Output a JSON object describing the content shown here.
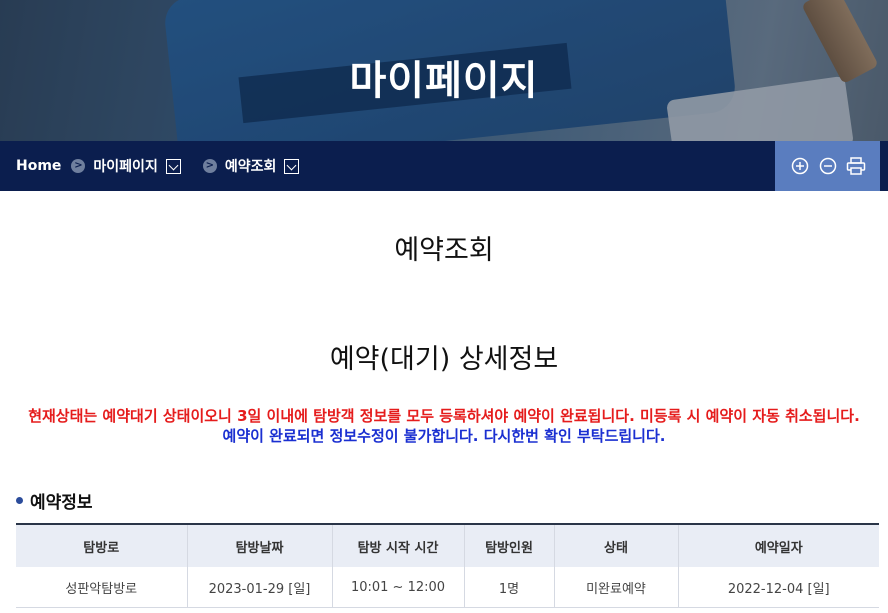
{
  "hero": {
    "title": "마이페이지"
  },
  "breadcrumb": {
    "home": "Home",
    "level1": "마이페이지",
    "level2": "예약조회"
  },
  "page": {
    "title": "예약조회"
  },
  "detail": {
    "title": "예약(대기) 상세정보",
    "notice_red": "현재상태는 예약대기 상태이오니 3일 이내에 탐방객 정보를 모두 등록하셔야 예약이 완료됩니다. 미등록 시 예약이 자동 취소됩니다.",
    "notice_blue": "예약이 완료되면 정보수정이 불가합니다. 다시한번 확인 부탁드립니다."
  },
  "reservation_info": {
    "heading": "예약정보",
    "columns": [
      "탐방로",
      "탐방날짜",
      "탐방 시작 시간",
      "탐방인원",
      "상태",
      "예약일자"
    ],
    "rows": [
      [
        "성판악탐방로",
        "2023-01-29 [일]",
        "10:01 ~ 12:00",
        "1명",
        "미완료예약",
        "2022-12-04 [일]"
      ]
    ]
  },
  "tools": {
    "icons": [
      "zoom-in-icon",
      "zoom-out-icon",
      "print-icon"
    ]
  },
  "colors": {
    "nav_bg": "#0b1e4e",
    "tools_bg": "#5a7dbf",
    "notice_red": "#e51c1c",
    "notice_blue": "#1a2fd1"
  }
}
